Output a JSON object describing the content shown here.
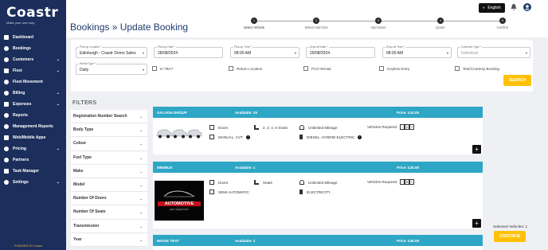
{
  "brand": {
    "name": "Coastr",
    "tagline": "Make your own way"
  },
  "sidebar": {
    "items": [
      {
        "label": "Dashboard",
        "icon": "dashboard-icon",
        "chevron": false
      },
      {
        "label": "Bookings",
        "icon": "bookings-icon",
        "chevron": false
      },
      {
        "label": "Customers",
        "icon": "customers-icon",
        "chevron": true
      },
      {
        "label": "Fleet",
        "icon": "fleet-icon",
        "chevron": true
      },
      {
        "label": "Fleet Movement",
        "icon": "fleet-movement-icon",
        "chevron": false
      },
      {
        "label": "Billing",
        "icon": "billing-icon",
        "chevron": true
      },
      {
        "label": "Expenses",
        "icon": "expenses-icon",
        "chevron": true
      },
      {
        "label": "Reports",
        "icon": "reports-icon",
        "chevron": false
      },
      {
        "label": "Management Reports",
        "icon": "management-reports-icon",
        "chevron": false
      },
      {
        "label": "Web/Mobile Apps",
        "icon": "apps-icon",
        "chevron": false
      },
      {
        "label": "Pricing",
        "icon": "pricing-icon",
        "chevron": true
      },
      {
        "label": "Partners",
        "icon": "partners-icon",
        "chevron": false
      },
      {
        "label": "Task Manager",
        "icon": "task-manager-icon",
        "chevron": false
      },
      {
        "label": "Settings",
        "icon": "settings-icon",
        "chevron": true
      }
    ],
    "powered_by": "POWERED BY Coastr"
  },
  "header": {
    "title": "Bookings  »  Update  Booking",
    "language": "English",
    "steps": [
      {
        "num": "1",
        "label": "Select Vehicle"
      },
      {
        "num": "2",
        "label": "Select Add-Ons"
      },
      {
        "num": "3",
        "label": "Add Driver"
      },
      {
        "num": "4",
        "label": "Quote"
      },
      {
        "num": "5",
        "label": "Confirm"
      }
    ]
  },
  "search": {
    "pickup_location": {
      "label": "Pick-up Location *",
      "value": "Edinburgh - Coastr Demo Sales"
    },
    "pickup_date": {
      "label": "Pick-up Date *",
      "value": "28/08/2024"
    },
    "pickup_time": {
      "label": "Pick-up Time *",
      "value": "08:00 AM"
    },
    "dropoff_date": {
      "label": "Drop-off Date *",
      "value": "29/08/2024"
    },
    "dropoff_time": {
      "label": "Drop-off Time *",
      "value": "08:00 AM"
    },
    "customer_type": {
      "label": "Customer Type *",
      "value": "Individual"
    },
    "rental_type": {
      "label": "Rental Type *",
      "value": "Daily"
    },
    "checkboxes": [
      "Is TBA?",
      "Return Location",
      "PCO Rental",
      "Keyless Entry",
      "Test/Courtesy Booking"
    ],
    "search_label": "SEARCH"
  },
  "filters": {
    "title": "FILTERS",
    "items": [
      "Registration Number Search",
      "Body Type",
      "Colour",
      "Fuel Type",
      "Make",
      "Model",
      "Number Of Doors",
      "Number Of Seats",
      "Transmission",
      "Year"
    ]
  },
  "vehicles": [
    {
      "group": "SALOON GROUP",
      "available": "Available: 29",
      "price": "Price: £10.00",
      "doors": "Doors",
      "seats": "2, 3, 4, 5 Seats",
      "mileage": "Unlimited Mileage",
      "transmission": "MANUAL, CVT",
      "fuel": "DIESEL, HYBRID ELECTRIC",
      "required_label": "Vehicles Required",
      "required": "1",
      "image": "three-cars-image"
    },
    {
      "group": "MINIBUS",
      "available": "Available: 1",
      "price": "Price: £20.00",
      "doors": "Doors",
      "seats": "Seats",
      "mileage": "Unlimited Mileage",
      "transmission": "SEMI AUTOMATIC",
      "fuel": "ELECTRICITY",
      "required_label": "Vehicles Required",
      "required": "0",
      "image": "automotive-logo-image",
      "image_text": "AUTOMOTIVE",
      "image_subtext": "your slogan here"
    },
    {
      "group": "IMAGE TEST",
      "available": "Available: 2",
      "price": "Price: £30.00"
    }
  ],
  "footer": {
    "selected": "Selected Vehicles: 1",
    "continue_label": "CONTINUE"
  },
  "colors": {
    "sidebar": "#1c2e5b",
    "accent": "#ffc107",
    "card_header": "#2ea6c5"
  }
}
